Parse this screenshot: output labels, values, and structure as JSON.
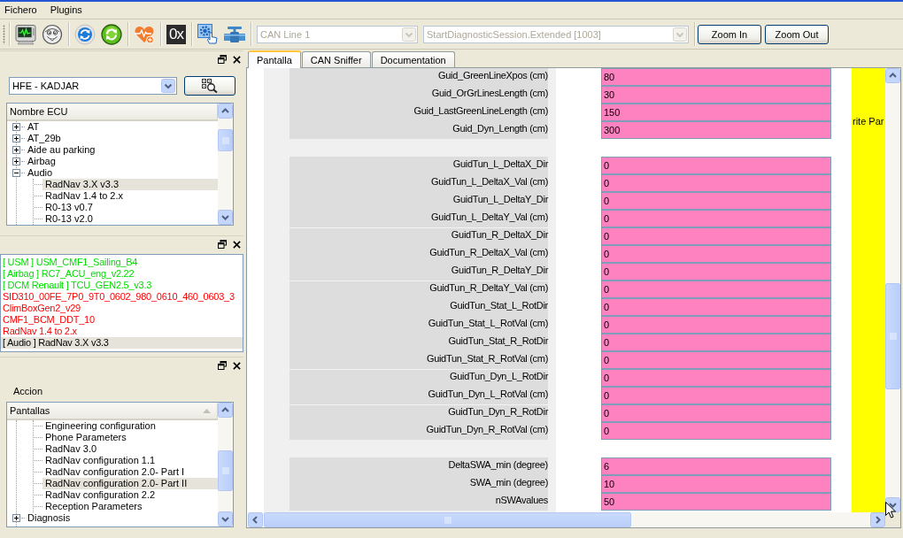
{
  "menu": [
    "Fichero",
    "Plugins"
  ],
  "toolbar": {
    "hex_label": "0x",
    "combos": [
      {
        "value": "CAN Line 1",
        "disabled": true
      },
      {
        "value": "StartDiagnosticSession.Extended [1003]",
        "disabled": true
      }
    ],
    "buttons": [
      "Zoom In",
      "Zoom Out"
    ]
  },
  "ecu_panel": {
    "vehicle": {
      "value": "HFE - KADJAR",
      "disabled": false
    },
    "tree": {
      "header": "Nombre ECU",
      "items": [
        {
          "label": "AT",
          "expanded": false,
          "selected": false
        },
        {
          "label": "AT_29b",
          "expanded": false,
          "selected": false
        },
        {
          "label": "Aide au parking",
          "expanded": false,
          "selected": false
        },
        {
          "label": "Airbag",
          "expanded": false,
          "selected": false
        },
        {
          "label": "Audio",
          "expanded": true,
          "selected": false,
          "children": [
            {
              "label": "RadNav 3.X v3.3",
              "selected": true
            },
            {
              "label": "RadNav 1.4 to 2.x",
              "selected": false
            },
            {
              "label": "R0-13 v0.7",
              "selected": false
            },
            {
              "label": "R0-13 v2.0",
              "selected": false
            }
          ]
        }
      ]
    }
  },
  "ecu_list_panel": {
    "items": [
      {
        "text": "[ USM ] USM_CMF1_Sailing_B4",
        "color": "#00dd00",
        "selected": false
      },
      {
        "text": "[ Airbag ] RC7_ACU_eng_v2.22",
        "color": "#00dd00",
        "selected": false
      },
      {
        "text": "[ DCM Renault ] TCU_GEN2.5_v3.3",
        "color": "#00dd00",
        "selected": false
      },
      {
        "text": "SID310_00FE_7P0_9T0_0602_980_0610_460_0603_3",
        "color": "#ff0000",
        "selected": false
      },
      {
        "text": "ClimBoxGen2_v29",
        "color": "#ff0000",
        "selected": false
      },
      {
        "text": "CMF1_BCM_DDT_10",
        "color": "#ff0000",
        "selected": false
      },
      {
        "text": "RadNav 1.4 to 2.x",
        "color": "#ff0000",
        "selected": false
      },
      {
        "text": "[ Audio ] RadNav 3.X v3.3",
        "color": "#000000",
        "selected": true
      }
    ]
  },
  "screens_panel": {
    "label": "Accion",
    "tree": {
      "header": "Pantallas",
      "items": [
        {
          "children": [
            {
              "label": "Engineering configuration",
              "selected": false
            },
            {
              "label": "Phone Parameters",
              "selected": false
            },
            {
              "label": "RadNav 3.0",
              "selected": false
            },
            {
              "label": "RadNav configuration 1.1",
              "selected": false
            },
            {
              "label": "RadNav configuration 2.0- Part I",
              "selected": false
            },
            {
              "label": "RadNav configuration 2.0- Part II",
              "selected": true
            },
            {
              "label": "RadNav configuration 2.2",
              "selected": false
            },
            {
              "label": "Reception Parameters",
              "selected": false
            }
          ]
        },
        {
          "label": "Diagnosis",
          "expanded": false,
          "selected": false
        }
      ]
    }
  },
  "tabs": [
    {
      "label": "Pantalla",
      "selected": true
    },
    {
      "label": "CAN Sniffer",
      "selected": false
    },
    {
      "label": "Documentation",
      "selected": false
    }
  ],
  "parameters": {
    "groups": [
      {
        "blocks": [
          {
            "rows": [
              {
                "label": "Guid_GreenLineXpos (cm)",
                "value": "80"
              },
              {
                "label": "Guid_OrGrLinesLength (cm)",
                "value": "30"
              },
              {
                "label": "Guid_LastGreenLineLength (cm)",
                "value": "150"
              },
              {
                "label": "Guid_Dyn_Length (cm)",
                "value": "300"
              }
            ]
          }
        ]
      },
      {
        "blocks": [
          {
            "rows": [
              {
                "label": "GuidTun_L_DeltaX_Dir",
                "value": "0"
              },
              {
                "label": "GuidTun_L_DeltaX_Val (cm)",
                "value": "0"
              },
              {
                "label": "GuidTun_L_DeltaY_Dir",
                "value": "0"
              },
              {
                "label": "GuidTun_L_DeltaY_Val (cm)",
                "value": "0"
              }
            ]
          },
          {
            "rows": [
              {
                "label": "GuidTun_R_DeltaX_Dir",
                "value": "0"
              },
              {
                "label": "GuidTun_R_DeltaX_Val (cm)",
                "value": "0"
              },
              {
                "label": "GuidTun_R_DeltaY_Dir",
                "value": "0"
              }
            ]
          },
          {
            "rows": [
              {
                "label": "GuidTun_R_DeltaY_Val (cm)",
                "value": "0"
              },
              {
                "label": "GuidTun_Stat_L_RotDir",
                "value": "0"
              },
              {
                "label": "GuidTun_Stat_L_RotVal (cm)",
                "value": "0"
              },
              {
                "label": "GuidTun_Stat_R_RotDir",
                "value": "0"
              },
              {
                "label": "GuidTun_Stat_R_RotVal (cm)",
                "value": "0"
              }
            ]
          },
          {
            "rows": [
              {
                "label": "GuidTun_Dyn_L_RotDir",
                "value": "0"
              },
              {
                "label": "GuidTun_Dyn_L_RotVal (cm)",
                "value": "0"
              }
            ]
          },
          {
            "rows": [
              {
                "label": "GuidTun_Dyn_R_RotDir",
                "value": "0"
              },
              {
                "label": "GuidTun_Dyn_R_RotVal (cm)",
                "value": "0"
              }
            ]
          }
        ]
      },
      {
        "blocks": [
          {
            "rows": [
              {
                "label": "DeltaSWA_min (degree)",
                "value": "6"
              },
              {
                "label": "SWA_min (degree)",
                "value": "10"
              },
              {
                "label": "nSWAvalues",
                "value": "50"
              }
            ]
          }
        ]
      }
    ],
    "side_button": "rite Par"
  }
}
